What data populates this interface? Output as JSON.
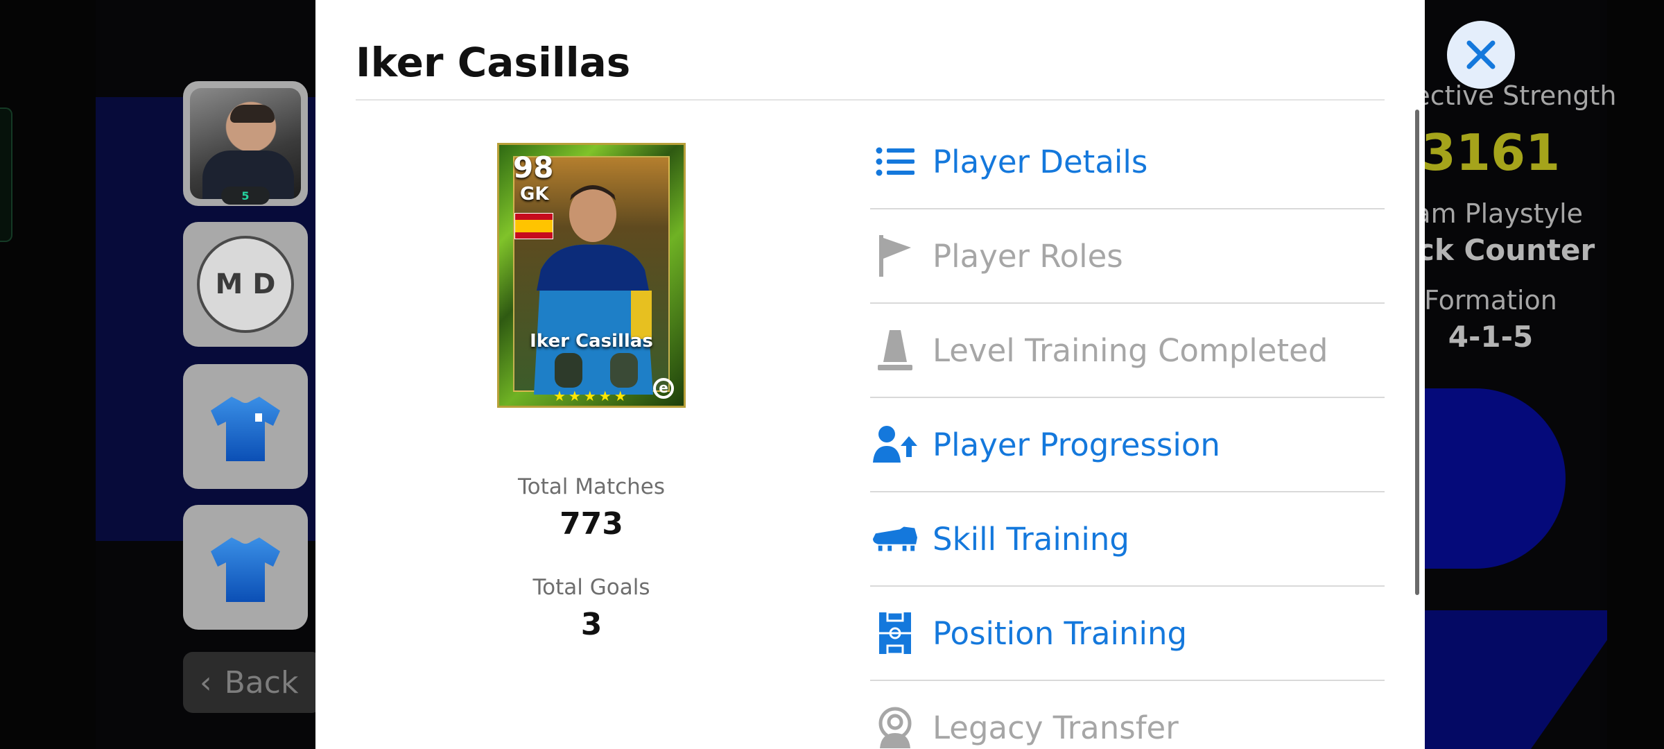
{
  "background": {
    "coach_badge": "5",
    "crest_text": "M D",
    "back_label": "Back",
    "collective_strength_label": "Collective Strength",
    "collective_strength_value": "3161",
    "team_playstyle_label": "eam Playstyle",
    "team_playstyle_value": "uick Counter",
    "formation_label": "Formation",
    "formation_value": "4-1-5"
  },
  "modal": {
    "title": "Iker Casillas",
    "card": {
      "rating": "98",
      "position": "GK",
      "name": "Iker Casillas",
      "stars": "★★★★★",
      "logo": "e"
    },
    "stats": [
      {
        "label": "Total Matches",
        "value": "773"
      },
      {
        "label": "Total Goals",
        "value": "3"
      }
    ],
    "menu": [
      {
        "label": "Player Details",
        "icon": "list-icon",
        "state": "active"
      },
      {
        "label": "Player Roles",
        "icon": "flag-icon",
        "state": "disabled"
      },
      {
        "label": "Level Training Completed",
        "icon": "cone-icon",
        "state": "disabled"
      },
      {
        "label": "Player Progression",
        "icon": "person-up-icon",
        "state": "active"
      },
      {
        "label": "Skill Training",
        "icon": "boot-icon",
        "state": "active"
      },
      {
        "label": "Position Training",
        "icon": "pitch-icon",
        "state": "active"
      },
      {
        "label": "Legacy Transfer",
        "icon": "person-badge-icon",
        "state": "disabled"
      }
    ]
  },
  "colors": {
    "accent_blue": "#1478dc",
    "disabled_gray": "#a6a6a6",
    "strength_yellow": "#a5a41b"
  }
}
